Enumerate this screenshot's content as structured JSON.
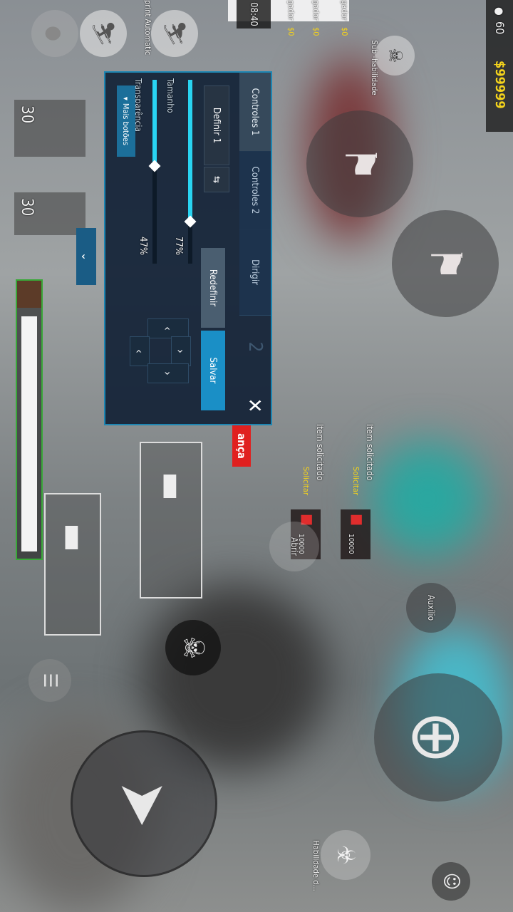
{
  "hud": {
    "signal_value": "60",
    "money": "$99999",
    "timer": "08:40",
    "players": [
      {
        "label": "gador",
        "money": "$0"
      },
      {
        "label": "gador",
        "money": "$0"
      },
      {
        "label": "gador",
        "money": "$0"
      }
    ],
    "skill_top_label": "Sub -habilidade",
    "skill_bottom_label": "Habilidade d...",
    "sprint_label": "print Automatic",
    "ammo_counts": [
      "30",
      "30"
    ],
    "help_label": "Auxílio",
    "open_label": "Abrir",
    "alert_label": "ança"
  },
  "requests": [
    {
      "title": "Item solicitado",
      "action": "Solicitar",
      "price": "10000"
    },
    {
      "title": "Item solicitado",
      "action": "Solicitar",
      "price": "10000"
    }
  ],
  "panel": {
    "tabs": [
      "Controles 1",
      "Controles 2",
      "Dirigir"
    ],
    "ghost_digit": "2",
    "define_button": "Definir 1",
    "reset_button": "Redefinir",
    "save_button": "Salvar",
    "size_label": "Tamanho",
    "size_value": "77%",
    "transparency_label": "Transparência",
    "transparency_value": "47%",
    "more_buttons": "Mais botões",
    "size_fraction": 0.77,
    "transparency_fraction": 0.47
  },
  "colors": {
    "accent": "#29d4f2",
    "money": "#f3d21c",
    "panel_border": "#1d86b3",
    "save_button": "#1a8fc6",
    "alert": "#e0201f"
  }
}
